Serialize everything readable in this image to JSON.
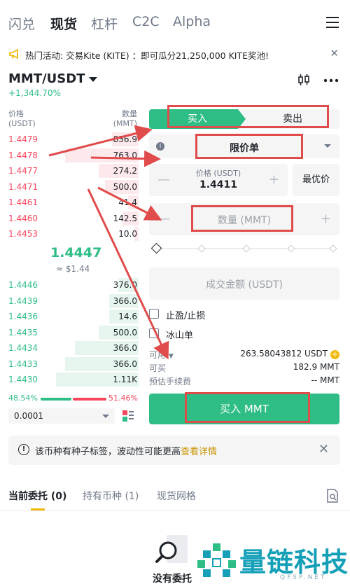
{
  "nav": {
    "tabs": [
      "闪兑",
      "现货",
      "杠杆",
      "C2C",
      "Alpha"
    ],
    "active": "现货"
  },
  "announcement": {
    "text": "热门活动: 交易Kite (KITE) ：即可瓜分21,250,000 KITE奖池!"
  },
  "pair": {
    "symbol": "MMT/USDT",
    "change": "+1,344.70%"
  },
  "orderbook": {
    "price_header": "价格",
    "price_unit": "(USDT)",
    "qty_header": "数量",
    "qty_unit": "(MMT)",
    "asks": [
      {
        "price": "1.4479",
        "qty": "836.9",
        "depth": 0.2
      },
      {
        "price": "1.4478",
        "qty": "763.0",
        "depth": 0.55
      },
      {
        "price": "1.4477",
        "qty": "274.2",
        "depth": 0.3
      },
      {
        "price": "1.4471",
        "qty": "500.0",
        "depth": 0.25
      },
      {
        "price": "1.4461",
        "qty": "41.4",
        "depth": 0.08
      },
      {
        "price": "1.4460",
        "qty": "142.5",
        "depth": 0.12
      },
      {
        "price": "1.4453",
        "qty": "10.0",
        "depth": 0.03
      }
    ],
    "last_price": "1.4447",
    "last_usd": "≈ $1.44",
    "bids": [
      {
        "price": "1.4446",
        "qty": "376.0",
        "depth": 0.15
      },
      {
        "price": "1.4439",
        "qty": "366.0",
        "depth": 0.22
      },
      {
        "price": "1.4436",
        "qty": "14.6",
        "depth": 0.22
      },
      {
        "price": "1.4435",
        "qty": "500.0",
        "depth": 0.3
      },
      {
        "price": "1.4434",
        "qty": "366.0",
        "depth": 0.48
      },
      {
        "price": "1.4433",
        "qty": "366.0",
        "depth": 0.55
      },
      {
        "price": "1.4430",
        "qty": "1.11K",
        "depth": 0.62
      }
    ],
    "buy_ratio": "48.54%",
    "sell_ratio": "51.46%",
    "tick_size": "0.0001"
  },
  "form": {
    "buy_tab": "买入",
    "sell_tab": "卖出",
    "order_type": "限价单",
    "price_label": "价格 (USDT)",
    "price_value": "1.4411",
    "best_price": "最优价",
    "qty_placeholder": "数量 (MMT)",
    "total_placeholder": "成交金额 (USDT)",
    "tp_sl": "止盈/止损",
    "iceberg": "冰山单",
    "available_label": "可用",
    "available_value": "263.58043812 USDT",
    "can_buy_label": "可买",
    "can_buy_value": "182.9 MMT",
    "fee_label": "预估手续费",
    "fee_value": "-- MMT",
    "submit": "买入 MMT"
  },
  "notice": {
    "text": "该币种有种子标签，波动性可能更高",
    "link": "查看详情"
  },
  "bottom_tabs": {
    "open_orders": "当前委托",
    "open_orders_count": "(0)",
    "holdings": "持有币种",
    "holdings_count": "(1)",
    "grid": "现货网格"
  },
  "empty_state": "没有委托",
  "watermark": {
    "cn": "量链科技",
    "en": "QFSP.NET"
  },
  "colors": {
    "buy": "#2ebd85",
    "sell": "#f6465d",
    "accent": "#f0b90b",
    "annotation": "#e04b4b"
  }
}
